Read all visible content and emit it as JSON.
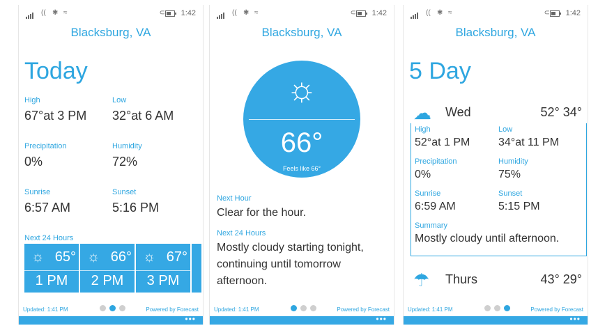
{
  "status": {
    "time": "1:42"
  },
  "screen1": {
    "city": "Blacksburg, VA",
    "title": "Today",
    "high_label": "High",
    "high_value": "67°at 3 PM",
    "low_label": "Low",
    "low_value": "32°at 6 AM",
    "precip_label": "Precipitation",
    "precip_value": "0%",
    "humidity_label": "Humidity",
    "humidity_value": "72%",
    "sunrise_label": "Sunrise",
    "sunrise_value": "6:57 AM",
    "sunset_label": "Sunset",
    "sunset_value": "5:16 PM",
    "next24_label": "Next 24 Hours",
    "hours": [
      {
        "temp": "65°",
        "time": "1 PM"
      },
      {
        "temp": "66°",
        "time": "2 PM"
      },
      {
        "temp": "67°",
        "time": "3 PM"
      }
    ],
    "updated": "Updated: 1:41 PM",
    "powered": "Powered by Forecast"
  },
  "screen2": {
    "city": "Blacksburg, VA",
    "temp": "66°",
    "feels": "Feels like 66°",
    "next_hour_label": "Next Hour",
    "next_hour_text": "Clear for the hour.",
    "next24_label": "Next 24 Hours",
    "next24_text": "Mostly cloudy starting tonight, continuing until tomorrow afternoon.",
    "updated": "Updated: 1:41 PM",
    "powered": "Powered by Forecast"
  },
  "screen3": {
    "city": "Blacksburg, VA",
    "title": "5 Day",
    "day1": {
      "name": "Wed",
      "high_low": "52°  34°"
    },
    "high_label": "High",
    "high_value": "52°at 1 PM",
    "low_label": "Low",
    "low_value": "34°at 11 PM",
    "precip_label": "Precipitation",
    "precip_value": "0%",
    "humidity_label": "Humidity",
    "humidity_value": "75%",
    "sunrise_label": "Sunrise",
    "sunrise_value": "6:59 AM",
    "sunset_label": "Sunset",
    "sunset_value": "5:15 PM",
    "summary_label": "Summary",
    "summary_value": "Mostly cloudy until afternoon.",
    "day2": {
      "name": "Thurs",
      "high_low": "43°  29°"
    },
    "updated": "Updated: 1:41 PM",
    "powered": "Powered by Forecast"
  },
  "icons": {
    "sun": "☼",
    "partly_cloudy": "☁",
    "rain": "☂",
    "more": "•••"
  },
  "colors": {
    "accent": "#2ea6e0",
    "tile": "#35a8e4"
  }
}
